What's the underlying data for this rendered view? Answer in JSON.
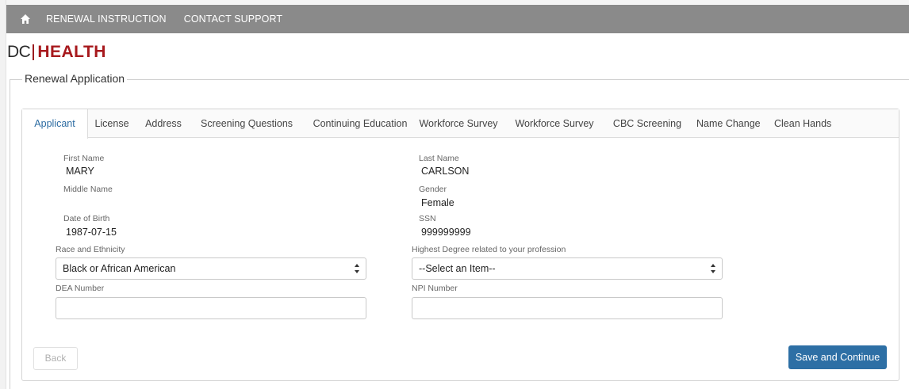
{
  "nav": {
    "home_icon": "home-icon",
    "links": [
      "RENEWAL INSTRUCTION",
      "CONTACT SUPPORT"
    ]
  },
  "logo": {
    "dc": "DC",
    "health": "HEALTH"
  },
  "section": {
    "legend": "Renewal Application"
  },
  "tabs": [
    {
      "label": "Applicant",
      "active": true
    },
    {
      "label": "License"
    },
    {
      "label": "Address"
    },
    {
      "label": "Screening Questions"
    },
    {
      "label": "Continuing Education"
    },
    {
      "label": "Workforce Survey"
    },
    {
      "label": "Workforce Survey"
    },
    {
      "label": "CBC Screening"
    },
    {
      "label": "Name Change"
    },
    {
      "label": "Clean Hands"
    }
  ],
  "form": {
    "first_name": {
      "label": "First Name",
      "value": "MARY"
    },
    "last_name": {
      "label": "Last Name",
      "value": "CARLSON"
    },
    "middle_name": {
      "label": "Middle Name",
      "value": ""
    },
    "gender": {
      "label": "Gender",
      "value": "Female"
    },
    "dob": {
      "label": "Date of Birth",
      "value": "1987-07-15"
    },
    "ssn": {
      "label": "SSN",
      "value": "999999999"
    },
    "race": {
      "label": "Race and Ethnicity",
      "selected": "Black or African American"
    },
    "degree": {
      "label": "Highest Degree related to your profession",
      "selected": "--Select an Item--"
    },
    "dea": {
      "label": "DEA Number",
      "value": ""
    },
    "npi": {
      "label": "NPI Number",
      "value": ""
    }
  },
  "buttons": {
    "back": "Back",
    "save": "Save and Continue"
  },
  "colors": {
    "navbar": "#8a8a8a",
    "brand_red": "#a7191d",
    "primary": "#2d6fa5",
    "active_tab": "#2d6ca2"
  }
}
